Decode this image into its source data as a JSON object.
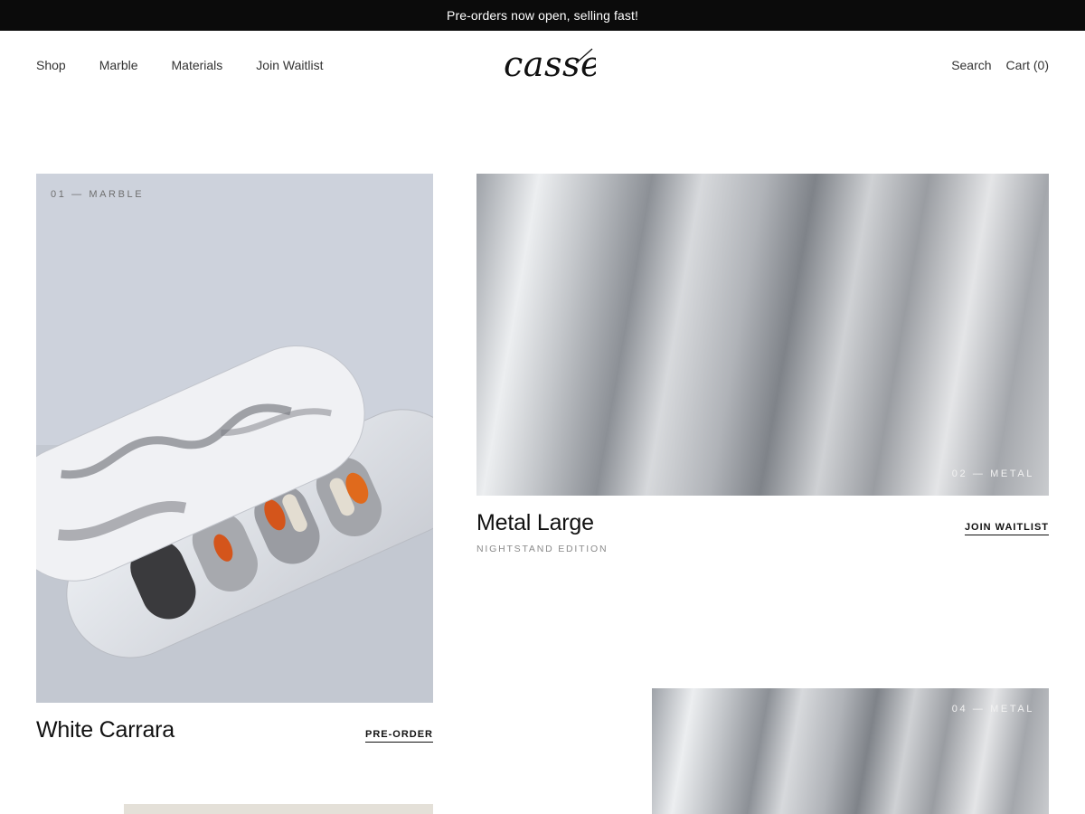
{
  "announcement": {
    "text": "Pre-orders now open, selling fast!"
  },
  "header": {
    "nav": [
      "Shop",
      "Marble",
      "Materials",
      "Join Waitlist"
    ],
    "logo": "cassel",
    "search_label": "Search",
    "cart_label": "Cart (0)"
  },
  "products": [
    {
      "badge": "01 — MARBLE",
      "title": "White Carrara",
      "subtitle": "",
      "cta": "PRE-ORDER"
    },
    {
      "badge": "02 — METAL",
      "title": "Metal Large",
      "subtitle": "NIGHTSTAND EDITION",
      "cta": "JOIN WAITLIST"
    },
    {
      "badge": "04 — METAL",
      "title": "",
      "subtitle": "",
      "cta": ""
    }
  ],
  "colors": {
    "announcement_bg": "#0b0b0b",
    "text": "#111111",
    "muted": "#8a8a8a"
  }
}
